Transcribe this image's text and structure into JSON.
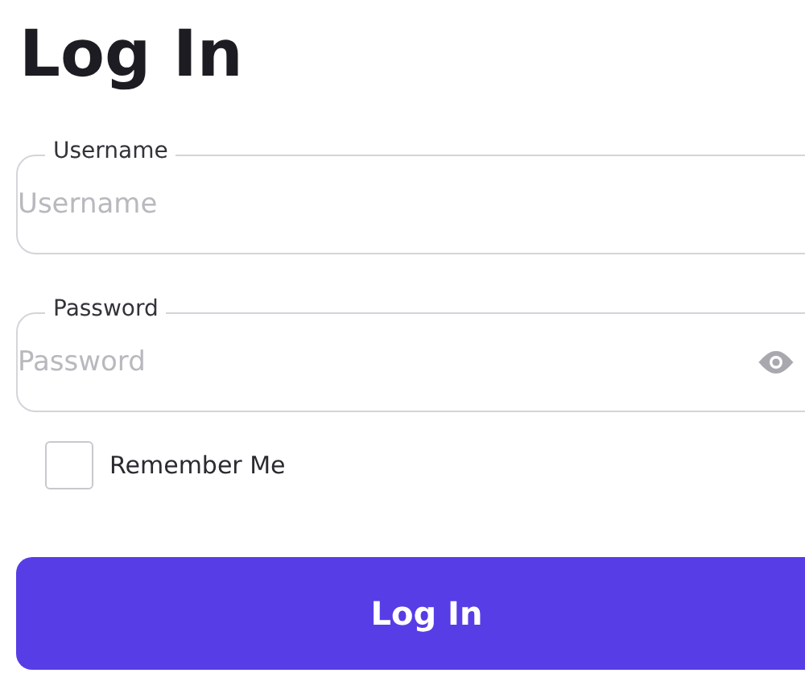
{
  "title": "Log In",
  "fields": [
    {
      "label": "Username",
      "placeholder": "Username",
      "kind": "text"
    },
    {
      "label": "Password",
      "placeholder": "Password",
      "kind": "password"
    }
  ],
  "remember": {
    "label": "Remember Me",
    "checked": false
  },
  "button": {
    "label": "Log In"
  }
}
